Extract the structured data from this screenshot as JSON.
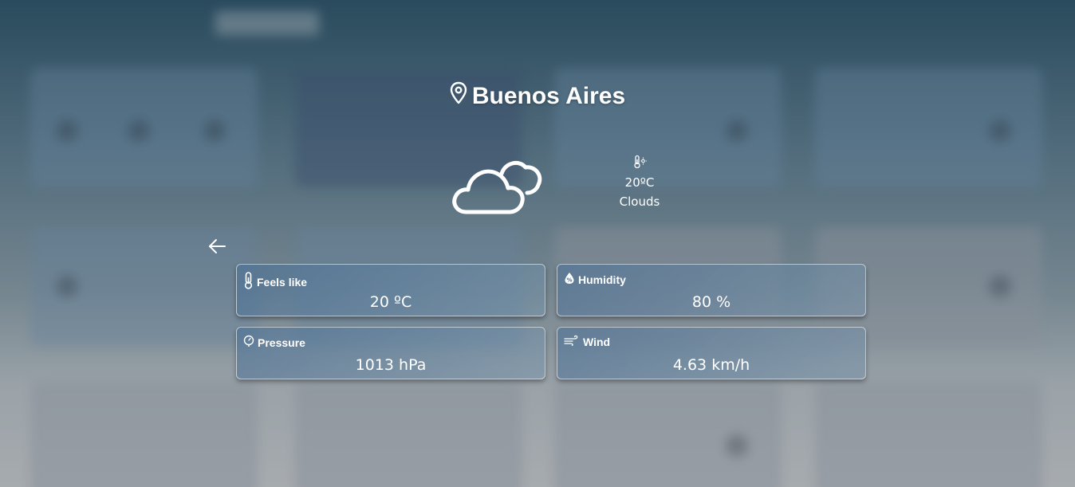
{
  "location": {
    "city": "Buenos Aires",
    "pin_icon": "map-pin-icon"
  },
  "current": {
    "icon": "clouds-icon",
    "temp_icon": "thermometer-sun-icon",
    "temperature": "20ºC",
    "condition": "Clouds"
  },
  "nav": {
    "back_icon": "arrow-left-icon"
  },
  "stats": {
    "feels_like": {
      "label": "Feels like",
      "value": "20 ºC",
      "icon": "thermometer-icon"
    },
    "humidity": {
      "label": "Humidity",
      "value": "80 %",
      "icon": "humidity-drop-icon"
    },
    "pressure": {
      "label": "Pressure",
      "value": "1013 hPa",
      "icon": "pressure-gauge-icon"
    },
    "wind": {
      "label": "Wind",
      "value": "4.63 km/h",
      "icon": "wind-icon"
    }
  },
  "colors": {
    "text": "#ffffff",
    "card_border": "#dfe8ef",
    "bg_top": "#2e5366",
    "bg_bottom": "#c6c8c9"
  }
}
